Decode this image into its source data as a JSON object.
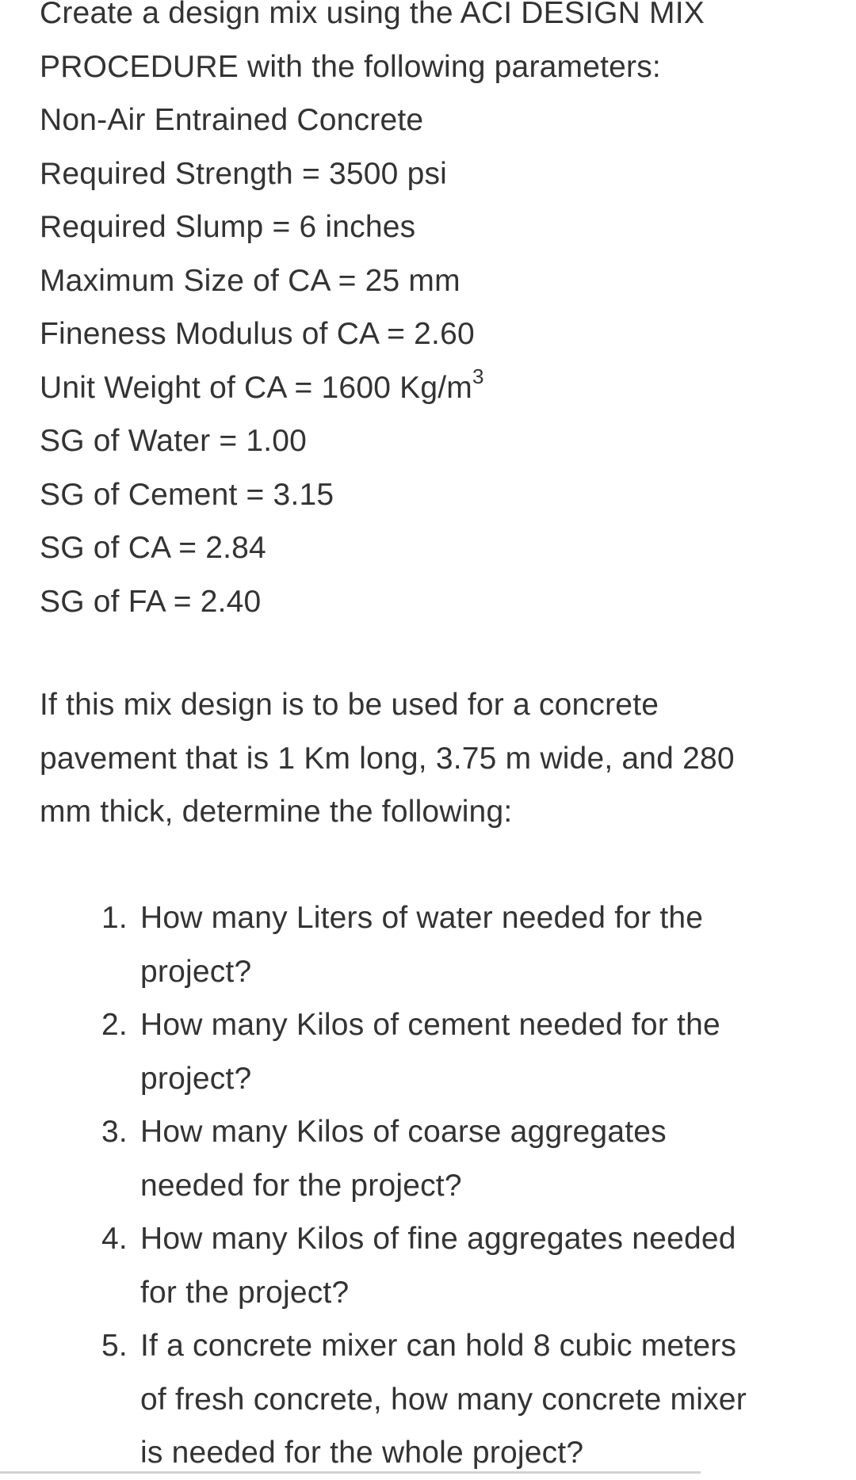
{
  "header_lines": [
    "Create a design mix using the ACI DESIGN MIX",
    "PROCEDURE with the following parameters:"
  ],
  "parameters": [
    {
      "text": "Non-Air Entrained Concrete"
    },
    {
      "text": "Required Strength = 3500 psi"
    },
    {
      "text": "Required Slump = 6 inches"
    },
    {
      "text": "Maximum Size of CA = 25 mm"
    },
    {
      "text": "Fineness Modulus of CA = 2.60"
    },
    {
      "text": "Unit Weight of CA = 1600 Kg/m",
      "superscript": "3"
    },
    {
      "text": "SG of Water = 1.00"
    },
    {
      "text": "SG of Cement = 3.15"
    },
    {
      "text": "SG of CA = 2.84"
    },
    {
      "text": "SG of FA = 2.40"
    }
  ],
  "intro_lines": [
    "If this mix design is to be used for a concrete",
    "pavement that is 1 Km long, 3.75 m wide, and 280",
    "mm thick, determine the following:"
  ],
  "questions": [
    {
      "number": "1.",
      "lines": [
        "How many Liters of water needed for the",
        "project?"
      ]
    },
    {
      "number": "2.",
      "lines": [
        "How many Kilos of cement needed for the",
        "project?"
      ]
    },
    {
      "number": "3.",
      "lines": [
        "How many Kilos of coarse aggregates",
        "needed for the project?"
      ]
    },
    {
      "number": "4.",
      "lines": [
        "How many Kilos of fine aggregates needed",
        "for the project?"
      ]
    },
    {
      "number": "5.",
      "lines": [
        "If a concrete mixer can hold 8 cubic meters",
        "of fresh concrete, how many concrete mixer",
        "is needed for the whole project?"
      ]
    }
  ]
}
